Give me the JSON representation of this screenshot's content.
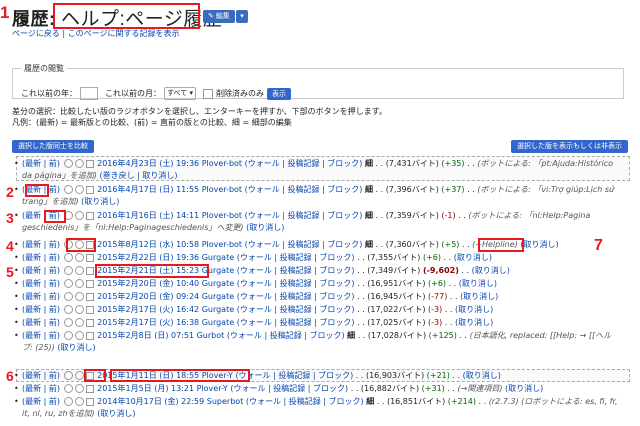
{
  "annotations": [
    "1",
    "2",
    "3",
    "4",
    "5",
    "6",
    "7"
  ],
  "header": {
    "title_label": "履歴:",
    "title_page": "ヘルプ:ページ履歴",
    "edit_label": "✎ 編集",
    "dropdown_label": "▾"
  },
  "sublinks": "ページに戻る | このページに関する記録を表示",
  "filter": {
    "legend": "履歴の閲覧",
    "year_label": "これ以前の年：",
    "month_label": "これ以前の月：",
    "month_value": "すべて ▾",
    "deleted_label": "削除済みのみ",
    "show_label": "表示"
  },
  "help": {
    "line1": "差分の選択：比較したい版のラジオボタンを選択し、エンターキーを押すか、下部のボタンを押します。",
    "line2": "凡例：(最新) = 最新版との比較、(前) = 直前の版との比較、細 = 細部の編集"
  },
  "buttons": {
    "compare": "選択した版同士を比較",
    "hide": "選択した版を表示もしくは非表示"
  },
  "revisions": [
    {
      "ts": "2016年4月23日 (土) 19:36",
      "user": "Plover-bot",
      "tools": "(ウォール | 投稿記録 | ブロック)",
      "minor": "細",
      "size": ". . (7,431バイト)",
      "diff": "(+35)",
      "diffclass": "pos",
      "text": ". .",
      "cmt": "(ボットによる: 「pt:Ajuda:Histórico da página」を追加)",
      "undo": "(巻き戻し | 取り消し)"
    },
    {
      "ts": "2016年4月17日 (日) 11:55",
      "user": "Plover-bot",
      "tools": "(ウォール | 投稿記録 | ブロック)",
      "minor": "細",
      "size": ". . (7,396バイト)",
      "diff": "(+37)",
      "diffclass": "pos",
      "text": ". .",
      "cmt": "(ボットによる: 「vi:Trợ giúp:Lịch sử trang」を追加)",
      "undo": "(取り消し)"
    },
    {
      "ts": "2016年1月16日 (土) 14:11",
      "user": "Plover-bot",
      "tools": "(ウォール | 投稿記録 | ブロック)",
      "minor": "細",
      "size": ". . (7,359バイト)",
      "diff": "(-1)",
      "diffclass": "neg",
      "text": ". .",
      "cmt": "(ボットによる: 「nl:Help:Pagina geschiedenis」を「nl:Help:Paginageschiedenis」へ変更)",
      "undo": "(取り消し)"
    },
    {
      "ts": "2015年8月12日 (水) 10:58",
      "user": "Plover-bot",
      "tools": "(ウォール | 投稿記録 | ブロック)",
      "minor": "細",
      "size": ". . (7,360バイト)",
      "diff": "(+5)",
      "diffclass": "pos",
      "text": ". .",
      "cmt": "(+Helpline)",
      "undo": "(取り消し)"
    },
    {
      "ts": "2015年2月22日 (日) 19:36",
      "user": "Gurgate",
      "tools": "(ウォール | 投稿記録 | ブロック)",
      "minor": "",
      "size": ". . (7,355バイト)",
      "diff": "(+6)",
      "diffclass": "pos",
      "text": ". .",
      "cmt": "",
      "undo": "(取り消し)"
    },
    {
      "ts": "2015年2月21日 (土) 15:23",
      "user": "Gurgate",
      "tools": "(ウォール | 投稿記録 | ブロック)",
      "minor": "",
      "size": ". . (7,349バイト)",
      "diff": "(-9,602)",
      "diffclass": "neg-big",
      "text": ". .",
      "cmt": "",
      "undo": "(取り消し)"
    },
    {
      "ts": "2015年2月20日 (金) 10:40",
      "user": "Gurgate",
      "tools": "(ウォール | 投稿記録 | ブロック)",
      "minor": "",
      "size": ". . (16,951バイト)",
      "diff": "(+6)",
      "diffclass": "pos",
      "text": ". .",
      "cmt": "",
      "undo": "(取り消し)"
    },
    {
      "ts": "2015年2月20日 (金) 09:24",
      "user": "Gurgate",
      "tools": "(ウォール | 投稿記録 | ブロック)",
      "minor": "",
      "size": ". . (16,945バイト)",
      "diff": "(-77)",
      "diffclass": "neg",
      "text": ". .",
      "cmt": "",
      "undo": "(取り消し)"
    },
    {
      "ts": "2015年2月17日 (火) 16:42",
      "user": "Gurgate",
      "tools": "(ウォール | 投稿記録 | ブロック)",
      "minor": "",
      "size": ". . (17,022バイト)",
      "diff": "(-3)",
      "diffclass": "neg",
      "text": ". .",
      "cmt": "",
      "undo": "(取り消し)"
    },
    {
      "ts": "2015年2月17日 (火) 16:38",
      "user": "Gurgate",
      "tools": "(ウォール | 投稿記録 | ブロック)",
      "minor": "",
      "size": ". . (17,025バイト)",
      "diff": "(-3)",
      "diffclass": "neg",
      "text": ". .",
      "cmt": "",
      "undo": "(取り消し)"
    },
    {
      "ts": "2015年2月8日 (日) 07:51",
      "user": "Gurbot",
      "tools": "(ウォール | 投稿記録 | ブロック)",
      "minor": "細",
      "size": ". . (17,028バイト)",
      "diff": "(+125)",
      "diffclass": "pos",
      "text": ". .",
      "cmt": "(日本語化, replaced: [[Help: → [[ヘルプ: (25))",
      "undo": "(取り消し)"
    },
    {
      "ts": "2015年1月11日 (日) 18:55",
      "user": "Plover-Y",
      "tools": "(ウォール | 投稿記録 | ブロック)",
      "minor": "",
      "size": ". . (16,903バイト)",
      "diff": "(+21)",
      "diffclass": "pos",
      "text": ". .",
      "cmt": "",
      "undo": "(取り消し)"
    },
    {
      "ts": "2015年1月5日 (月) 13:21",
      "user": "Plover-Y",
      "tools": "(ウォール | 投稿記録 | ブロック)",
      "minor": "",
      "size": ". . (16,882バイト)",
      "diff": "(+31)",
      "diffclass": "pos",
      "text": ". .",
      "cmt": "(→関連項目)",
      "undo": "(取り消し)"
    },
    {
      "ts": "2014年10月17日 (金) 22:59",
      "user": "Superbot",
      "tools": "(ウォール | 投稿記録 | ブロック)",
      "minor": "細",
      "size": ". . (16,851バイト)",
      "diff": "(+214)",
      "diffclass": "pos",
      "text": ". .",
      "cmt": "(r2.7.3) (ロボットによる: es, fi, fr, it, nl, ru, zhを追加)",
      "undo": "(取り消し)"
    }
  ],
  "row_prefix": "(最新 | 前)"
}
